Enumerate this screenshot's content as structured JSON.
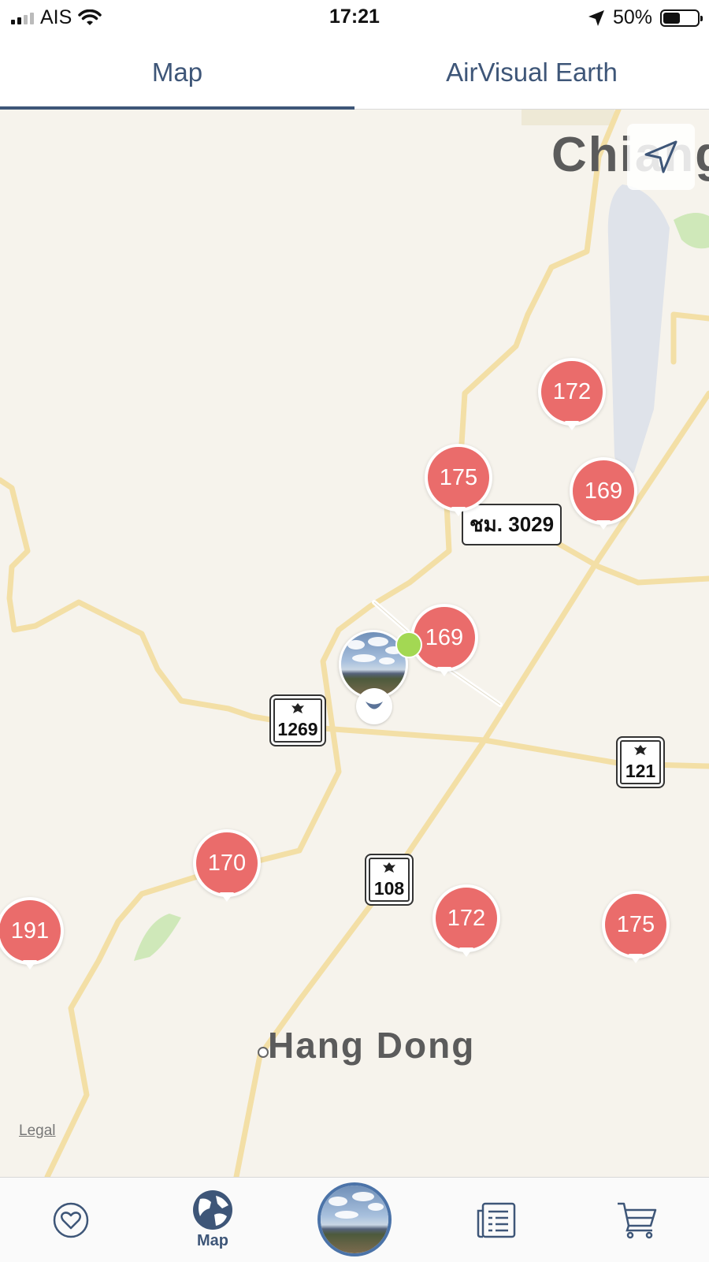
{
  "status_bar": {
    "carrier": "AIS",
    "time": "17:21",
    "battery_percent": "50%",
    "battery_level": 0.5,
    "icons": [
      "signal-icon",
      "wifi-icon",
      "location-arrow-icon",
      "battery-icon"
    ]
  },
  "tabs": [
    {
      "label": "Map",
      "selected": true
    },
    {
      "label": "AirVisual Earth",
      "selected": false
    }
  ],
  "map": {
    "places": {
      "chiang": "Chiang",
      "hang_dong": "Hang Dong"
    },
    "highway_shields": [
      "1269",
      "121",
      "108"
    ],
    "road_label": "ชม. 3029",
    "legal": "Legal",
    "aqi_markers": [
      "172",
      "175",
      "169",
      "169",
      "170",
      "191",
      "172",
      "175"
    ],
    "marker_color": "#ea6c6b",
    "locate_icon": "navigation-arrow-icon"
  },
  "bottom_nav": {
    "items": [
      {
        "icon": "heart-icon",
        "label": ""
      },
      {
        "icon": "globe-icon",
        "label": "Map"
      },
      {
        "icon": "profile-photo",
        "label": ""
      },
      {
        "icon": "news-icon",
        "label": ""
      },
      {
        "icon": "cart-icon",
        "label": ""
      }
    ],
    "accent": "#3e5678"
  }
}
